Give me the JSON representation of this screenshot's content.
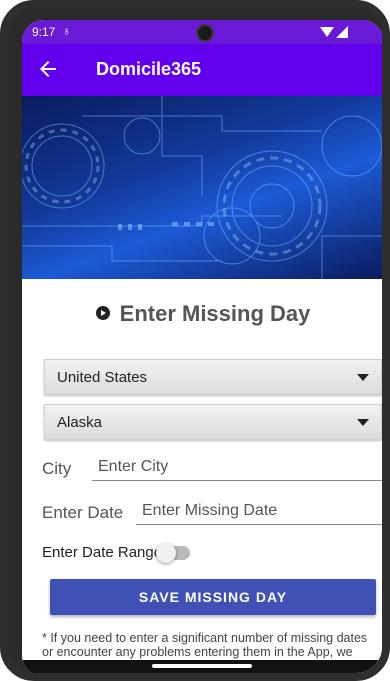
{
  "status_bar": {
    "time": "9:17",
    "sync_glyph": "♁"
  },
  "app_bar": {
    "title": "Domicile365",
    "back_icon": "arrow-left-icon"
  },
  "page": {
    "heading": "Enter Missing Day",
    "heading_icon": "play-circle-icon",
    "country_select": {
      "value": "United States"
    },
    "state_select": {
      "value": "Alaska"
    },
    "city": {
      "label": "City",
      "placeholder": "Enter City",
      "value": ""
    },
    "date": {
      "label": "Enter Date",
      "placeholder": "Enter Missing Date",
      "value": ""
    },
    "date_range": {
      "label": "Enter Date Range?",
      "enabled": false
    },
    "save_button": "SAVE MISSING DAY",
    "note": "* If you need to enter a significant number of missing dates or encounter any problems entering them in the App, we encourage you to enter them on the website"
  },
  "colors": {
    "status_bar": "#6a1ad6",
    "app_bar": "#6200ee",
    "button": "#3f51b5"
  }
}
